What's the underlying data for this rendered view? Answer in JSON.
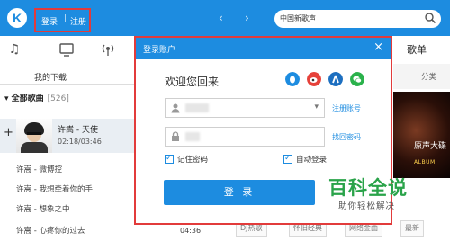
{
  "header": {
    "logo_letter": "K",
    "login_label": "登录",
    "separator": "|",
    "register_label": "注册",
    "back_arrow": "‹",
    "forward_arrow": "›",
    "search_value": "中国新歌声"
  },
  "left_panel": {
    "my_download": "我的下载",
    "all_songs": "全部歌曲",
    "all_songs_count": "[526]",
    "active_song": {
      "title": "许嵩 - 天使",
      "time": "02:18/03:46"
    },
    "songs": [
      "许嵩 - 微博控",
      "许嵩 - 我想牵着你的手",
      "许嵩 - 想象之中",
      "许嵩 - 心疼你的过去"
    ]
  },
  "right_panel": {
    "tab_label": "歌单",
    "sub_tab": "分类",
    "album_title": "原声大碟",
    "album_sub": "ALBUM"
  },
  "bottom": {
    "duration": "04:36",
    "chips": [
      "DJ热歌",
      "怀旧经典",
      "网络金曲",
      "最新"
    ]
  },
  "dialog": {
    "title": "登录账户",
    "close": "×",
    "welcome": "欢迎您回来",
    "username_value": "        ",
    "password_value": "    ",
    "dropdown_arrow": "▾",
    "register_link": "注册账号",
    "forgot_link": "找回密码",
    "remember_label": "记住密码",
    "autologin_label": "自动登录",
    "login_button": "登 录"
  },
  "watermark": {
    "big": "百科全说",
    "small": "助你轻松解决"
  },
  "colors": {
    "brand_blue": "#1d8ce0",
    "highlight_red": "#e23b3b",
    "watermark_green": "#2aa34a"
  }
}
